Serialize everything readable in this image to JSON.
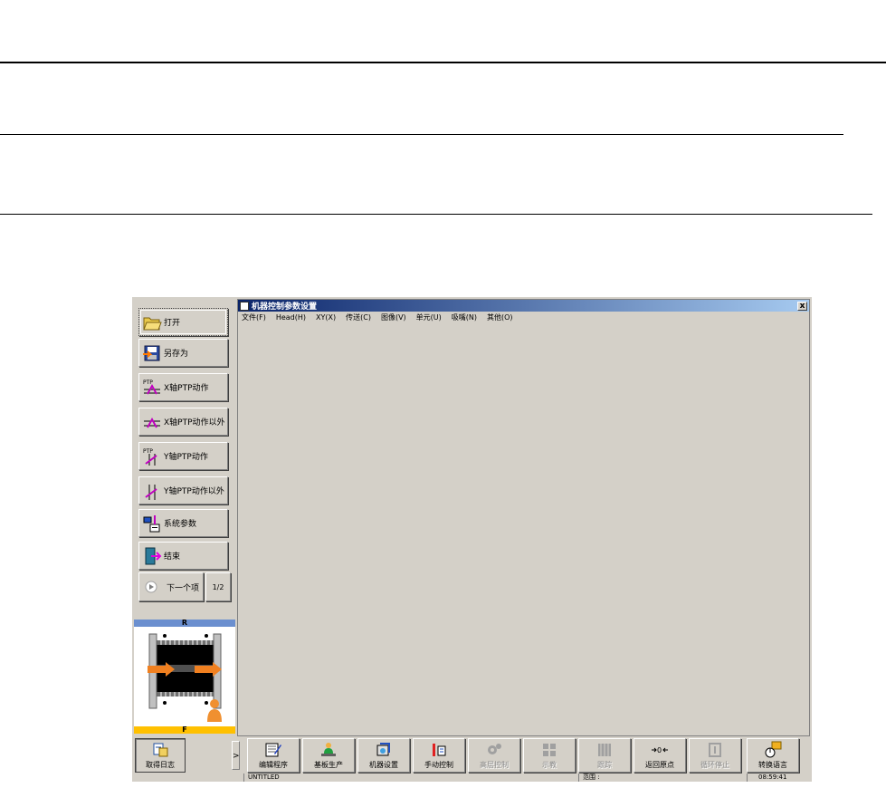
{
  "sidebar": {
    "items": [
      {
        "label": "打开"
      },
      {
        "label": "另存为"
      },
      {
        "label": "X轴PTP动作"
      },
      {
        "label": "X轴PTP动作以外"
      },
      {
        "label": "Y轴PTP动作"
      },
      {
        "label": "Y轴PTP动作以外"
      },
      {
        "label": "系统参数"
      },
      {
        "label": "结束"
      }
    ],
    "next_label": "下一个项",
    "page_indicator": "1/2"
  },
  "diagram": {
    "top_label": "R",
    "bottom_label": "F"
  },
  "window": {
    "title": "机器控制参数设置",
    "close_label": "x",
    "menu": [
      "文件(F)",
      "Head(H)",
      "XY(X)",
      "传送(C)",
      "图像(V)",
      "单元(U)",
      "吸嘴(N)",
      "其他(O)"
    ]
  },
  "toolbar": {
    "log_label": "取得日志",
    "expander_label": ">",
    "buttons": [
      {
        "label": "编辑程序",
        "enabled": true
      },
      {
        "label": "基板生产",
        "enabled": true
      },
      {
        "label": "机器设置",
        "enabled": true
      },
      {
        "label": "手动控制",
        "enabled": true
      },
      {
        "label": "高层控制",
        "enabled": false
      },
      {
        "label": "示教",
        "enabled": false
      },
      {
        "label": "跟踪",
        "enabled": false
      },
      {
        "label": "返回原点",
        "enabled": true
      },
      {
        "label": "循环停止",
        "enabled": false
      },
      {
        "label": "转换语言",
        "enabled": true
      }
    ]
  },
  "status": {
    "file": "UNTITLED",
    "range_label": "范围 :",
    "time": "08:59:41"
  }
}
